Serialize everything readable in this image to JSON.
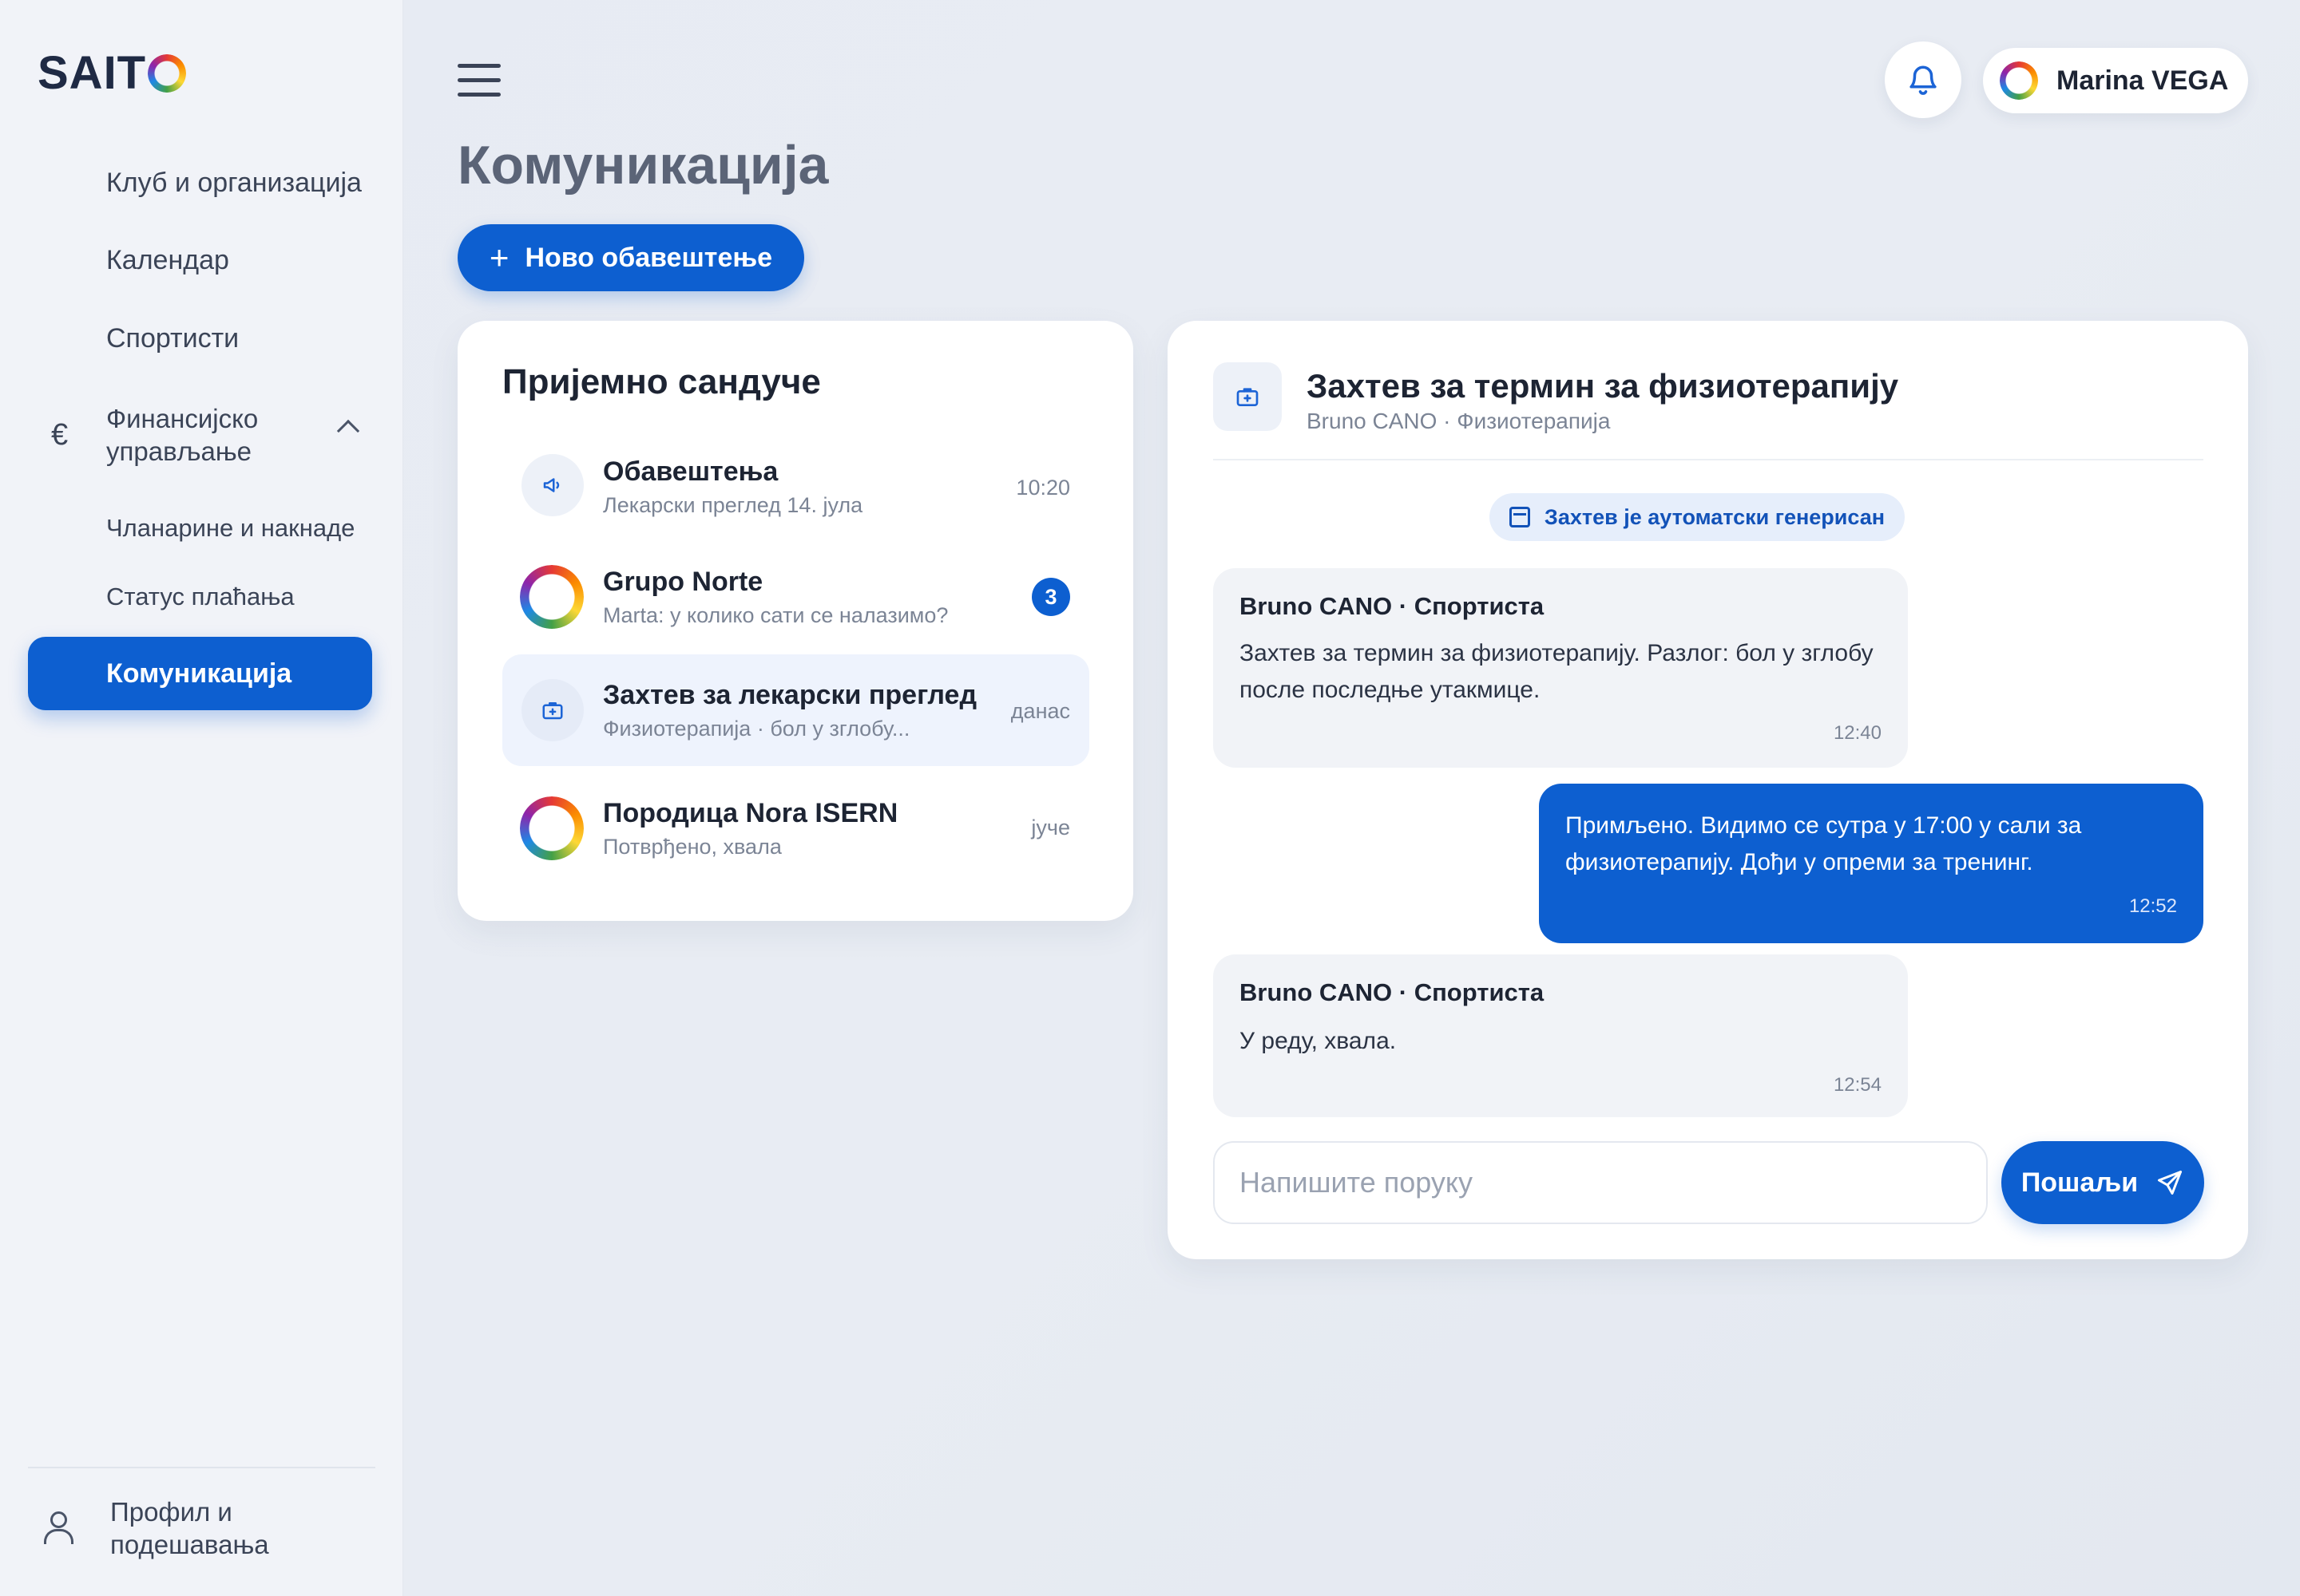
{
  "app": {
    "logo_text": "SAIT",
    "logo_last_letter": "O"
  },
  "sidebar": {
    "items": [
      {
        "label": "Клуб и организација"
      },
      {
        "label": "Календар"
      },
      {
        "label": "Спортисти"
      }
    ],
    "finance_group": {
      "icon_symbol": "€",
      "label": "Финансијско управљање",
      "expanded": true,
      "sub_items": [
        {
          "label": "Чланарине и накнаде"
        },
        {
          "label": "Статус плаћања"
        }
      ]
    },
    "active_item": {
      "label": "Комуникација"
    },
    "profile": {
      "label": "Профил и подешавања"
    }
  },
  "header": {
    "user_name": "Marina VEGA"
  },
  "page": {
    "title": "Комуникација",
    "new_button_label": "Ново обавештење",
    "new_button_symbol": "+"
  },
  "inbox": {
    "title": "Пријемно сандуче",
    "items": [
      {
        "title": "Обавештења",
        "subtitle": "Лекарски преглед 14. јула",
        "time": "10:20",
        "icon": "megaphone-icon"
      },
      {
        "title": "Grupo Norte",
        "subtitle": "Marta: у колико сати се налазимо?",
        "unread": "3",
        "icon": "ring-avatar"
      },
      {
        "title": "Захтев за лекарски преглед",
        "subtitle": "Физиотерапија · бол у зглобу...",
        "time": "данас",
        "icon": "medical-bag-icon",
        "selected": true
      },
      {
        "title": "Породица Nora ISERN",
        "subtitle": "Потврђено, хвала",
        "time": "јуче",
        "icon": "ring-avatar"
      }
    ]
  },
  "conversation": {
    "title": "Захтев за термин за физиотерапију",
    "subtitle": "Bruno CANO · Физиотерапија",
    "system_notice": "Захтев је аутоматски генерисан",
    "messages": [
      {
        "direction": "incoming",
        "sender": "Bruno CANO · Спортиста",
        "text": "Захтев за термин за физиотерапију. Разлог: бол у зглобу после последње утакмице.",
        "time": "12:40"
      },
      {
        "direction": "outgoing",
        "text": "Примљено. Видимо се сутра у 17:00 у сали за физиотерапију. Дођи у опреми за тренинг.",
        "time": "12:52"
      },
      {
        "direction": "incoming",
        "sender": "Bruno CANO · Спортиста",
        "text": "У реду, хвала.",
        "time": "12:54"
      }
    ],
    "composer": {
      "placeholder": "Напишите поруку",
      "value": "",
      "send_label": "Пошаљи"
    }
  },
  "colors": {
    "accent": "#0d5fd0",
    "background": "#e8ecf3",
    "card": "#ffffff",
    "text_primary": "#1d2433",
    "text_secondary": "#7b8495"
  }
}
